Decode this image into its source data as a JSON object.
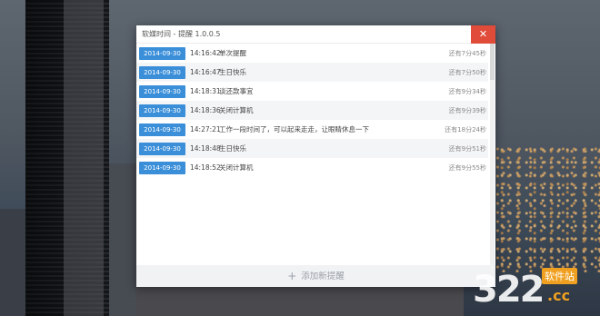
{
  "window": {
    "title": "软媒时间 - 提醒 1.0.0.5",
    "close_label": "✕"
  },
  "reminders": [
    {
      "date": "2014-09-30",
      "time": "14:16:42",
      "message": "单次提醒",
      "remaining": "还有7分45秒"
    },
    {
      "date": "2014-09-30",
      "time": "14:16:47",
      "message": "生日快乐",
      "remaining": "还有7分50秒"
    },
    {
      "date": "2014-09-30",
      "time": "14:18:31",
      "message": "谈还款事宜",
      "remaining": "还有9分34秒"
    },
    {
      "date": "2014-09-30",
      "time": "14:18:36",
      "message": "关闭计算机",
      "remaining": "还有9分39秒"
    },
    {
      "date": "2014-09-30",
      "time": "14:27:21",
      "message": "工作一段时间了，可以起来走走，让眼睛休息一下",
      "remaining": "还有18分24秒"
    },
    {
      "date": "2014-09-30",
      "time": "14:18:48",
      "message": "生日快乐",
      "remaining": "还有9分51秒"
    },
    {
      "date": "2014-09-30",
      "time": "14:18:52",
      "message": "关闭计算机",
      "remaining": "还有9分55秒"
    }
  ],
  "footer": {
    "plus_icon": "+",
    "add_label": "添加新提醒"
  },
  "watermark": {
    "number": "322",
    "site": "软件站",
    "domain": ".cc"
  },
  "colors": {
    "accent": "#3b8fd9",
    "close": "#e04b3a"
  }
}
